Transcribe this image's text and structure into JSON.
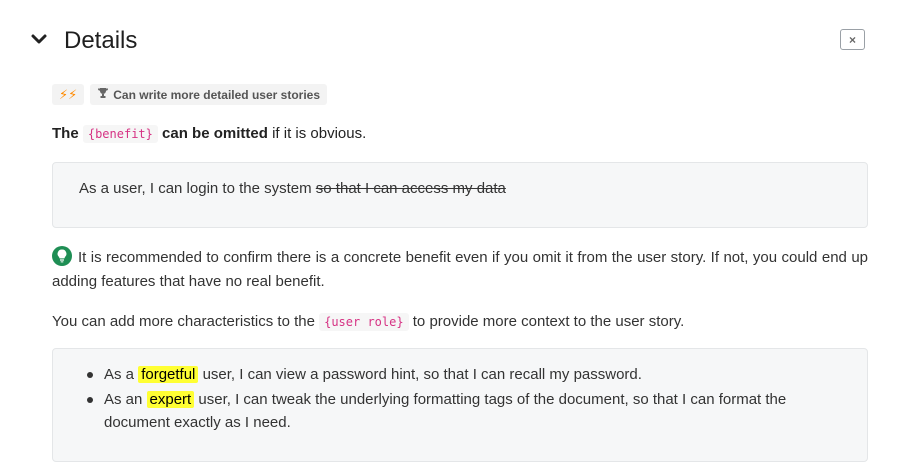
{
  "section": {
    "title": "Details",
    "close_label": "×"
  },
  "badges": {
    "zap": "⚡⚡",
    "achievement": "Can write more detailed user stories"
  },
  "benefit_omit": {
    "prefix": "The",
    "code": "{benefit}",
    "bold_suffix": "can be omitted",
    "rest": "if it is obvious."
  },
  "example1": {
    "plain": "As a user, I can login to the system",
    "struck": "so that I can access my data"
  },
  "tip": {
    "text": "It is recommended to confirm there is a concrete benefit even if you omit it from the user story. If not, you could end up adding features that have no real benefit."
  },
  "user_role": {
    "prefix": "You can add more characteristics to the",
    "code": "{user role}",
    "suffix": "to provide more context to the user story."
  },
  "examples": [
    {
      "pre": "As a",
      "highlight": "forgetful",
      "post": "user, I can view a password hint, so that I can recall my password."
    },
    {
      "pre": "As an",
      "highlight": "expert",
      "post": "user, I can tweak the underlying formatting tags of the document, so that I can format the document exactly as I need."
    }
  ],
  "colors": {
    "highlight": "#ffff33",
    "code_text": "#d63384",
    "tip_icon": "#1e8e54",
    "zap": "#ff8a00"
  }
}
